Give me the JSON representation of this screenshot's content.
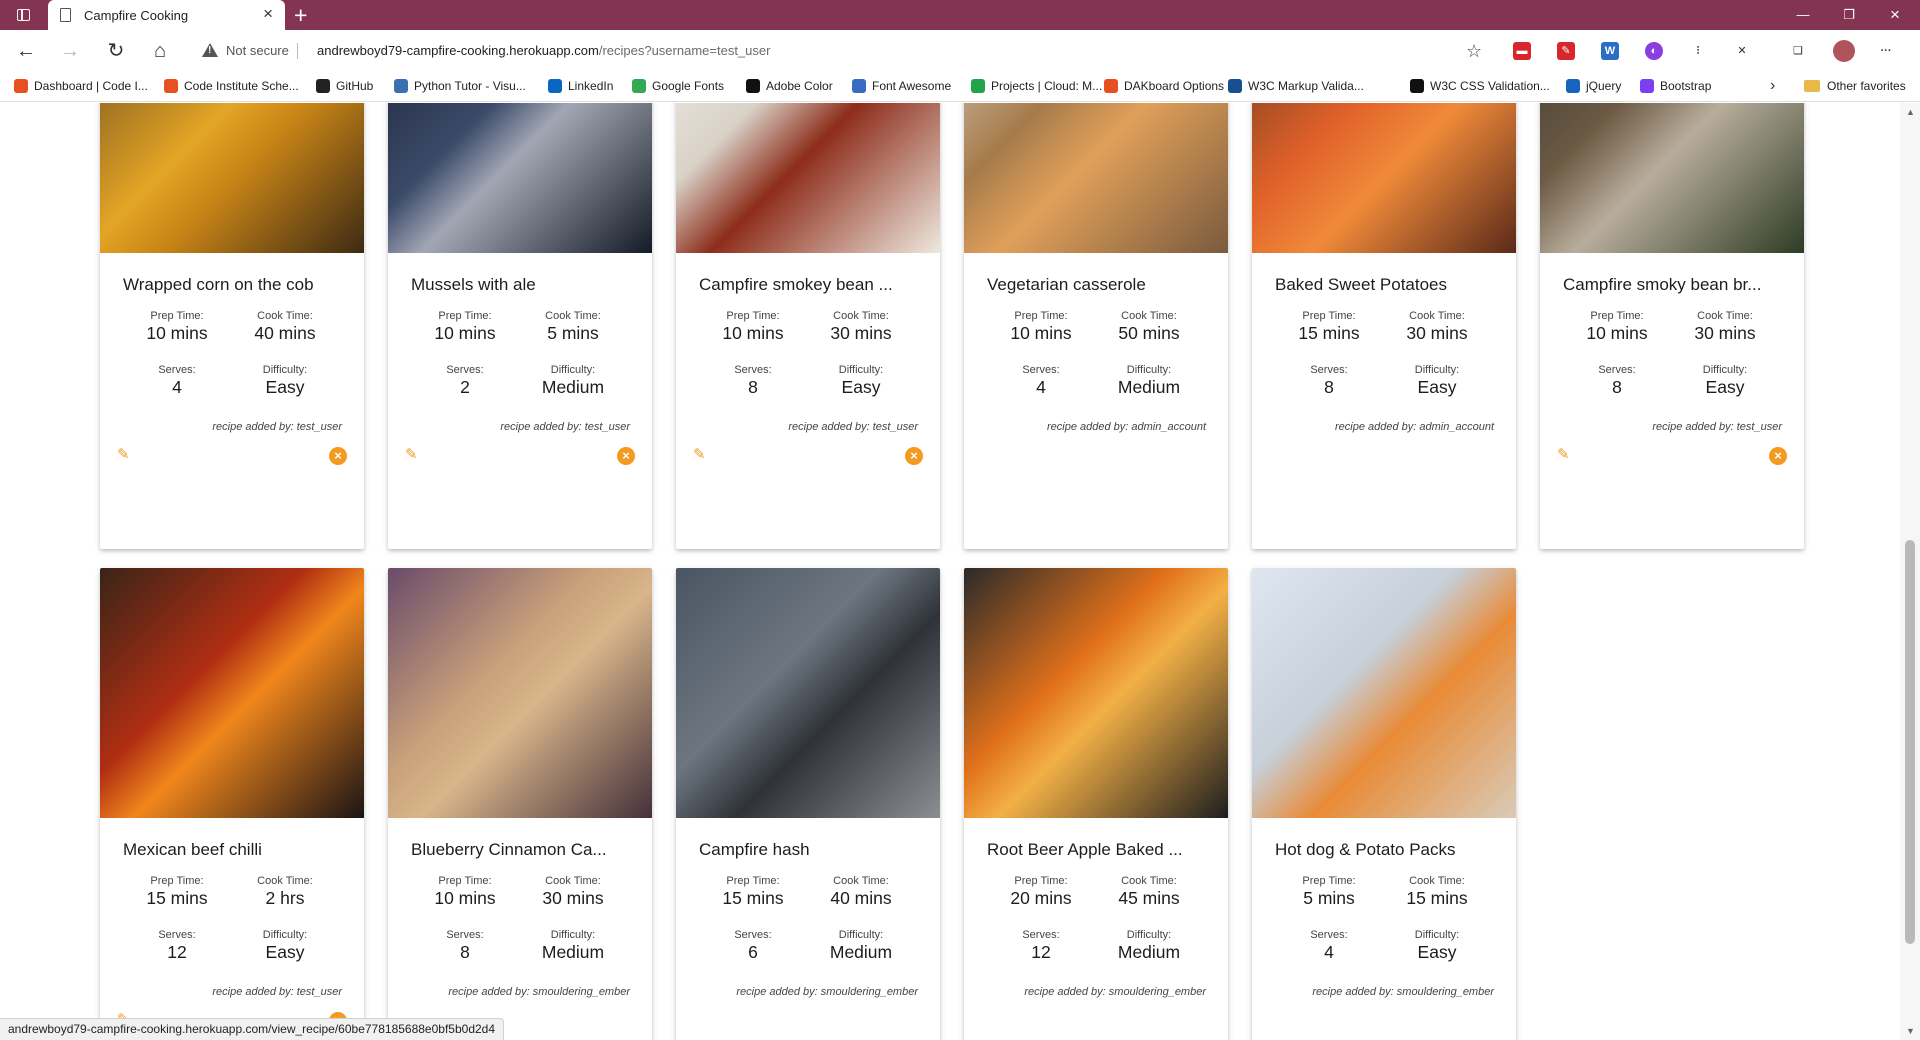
{
  "browser": {
    "tab_title": "Campfire Cooking",
    "not_secure": "Not secure",
    "url_host": "andrewboyd79-campfire-cooking.herokuapp.com",
    "url_rest": "/recipes?username=test_user",
    "status_url": "andrewboyd79-campfire-cooking.herokuapp.com/view_recipe/60be778185688e0bf5b0d2d4",
    "other_favorites": "Other favorites",
    "bookmarks": [
      {
        "label": "Dashboard | Code I...",
        "color": "#e8501f"
      },
      {
        "label": "Code Institute Sche...",
        "color": "#e8501f"
      },
      {
        "label": "GitHub",
        "color": "#222222"
      },
      {
        "label": "Python Tutor - Visu...",
        "color": "#3a6fb0"
      },
      {
        "label": "LinkedIn",
        "color": "#0a66c2"
      },
      {
        "label": "Google Fonts",
        "color": "#34a853"
      },
      {
        "label": "Adobe Color",
        "color": "#111111"
      },
      {
        "label": "Font Awesome",
        "color": "#3b6cc4"
      },
      {
        "label": "Projects | Cloud: M...",
        "color": "#23a349"
      },
      {
        "label": "DAKboard Options",
        "color": "#e8501f"
      },
      {
        "label": "W3C Markup Valida...",
        "color": "#1a4f8f"
      },
      {
        "label": "W3C CSS Validation...",
        "color": "#111111"
      },
      {
        "label": "jQuery",
        "color": "#1565c0"
      },
      {
        "label": "Bootstrap",
        "color": "#7b3ff2"
      }
    ]
  },
  "ui": {
    "prep_label": "Prep Time:",
    "cook_label": "Cook Time:",
    "serves_label": "Serves:",
    "difficulty_label": "Difficulty:",
    "added_prefix": "recipe added by: ",
    "accent": "#f29b1f"
  },
  "recipes": [
    {
      "title": "Wrapped corn on the cob",
      "prep": "10 mins",
      "cook": "40 mins",
      "serves": "4",
      "difficulty": "Easy",
      "added_by": "test_user",
      "editable": true
    },
    {
      "title": "Mussels with ale",
      "prep": "10 mins",
      "cook": "5 mins",
      "serves": "2",
      "difficulty": "Medium",
      "added_by": "test_user",
      "editable": true
    },
    {
      "title": "Campfire smokey bean ...",
      "prep": "10 mins",
      "cook": "30 mins",
      "serves": "8",
      "difficulty": "Easy",
      "added_by": "test_user",
      "editable": true
    },
    {
      "title": "Vegetarian casserole",
      "prep": "10 mins",
      "cook": "50 mins",
      "serves": "4",
      "difficulty": "Medium",
      "added_by": "admin_account",
      "editable": false
    },
    {
      "title": "Baked Sweet Potatoes",
      "prep": "15 mins",
      "cook": "30 mins",
      "serves": "8",
      "difficulty": "Easy",
      "added_by": "admin_account",
      "editable": false
    },
    {
      "title": "Campfire smoky bean br...",
      "prep": "10 mins",
      "cook": "30 mins",
      "serves": "8",
      "difficulty": "Easy",
      "added_by": "test_user",
      "editable": true
    },
    {
      "title": "Mexican beef chilli",
      "prep": "15 mins",
      "cook": "2 hrs",
      "serves": "12",
      "difficulty": "Easy",
      "added_by": "test_user",
      "editable": true
    },
    {
      "title": "Blueberry Cinnamon Ca...",
      "prep": "10 mins",
      "cook": "30 mins",
      "serves": "8",
      "difficulty": "Medium",
      "added_by": "smouldering_ember",
      "editable": false
    },
    {
      "title": "Campfire hash",
      "prep": "15 mins",
      "cook": "40 mins",
      "serves": "6",
      "difficulty": "Medium",
      "added_by": "smouldering_ember",
      "editable": false
    },
    {
      "title": "Root Beer Apple Baked ...",
      "prep": "20 mins",
      "cook": "45 mins",
      "serves": "12",
      "difficulty": "Medium",
      "added_by": "smouldering_ember",
      "editable": false
    },
    {
      "title": "Hot dog & Potato Packs",
      "prep": "5 mins",
      "cook": "15 mins",
      "serves": "4",
      "difficulty": "Easy",
      "added_by": "smouldering_ember",
      "editable": false
    }
  ]
}
